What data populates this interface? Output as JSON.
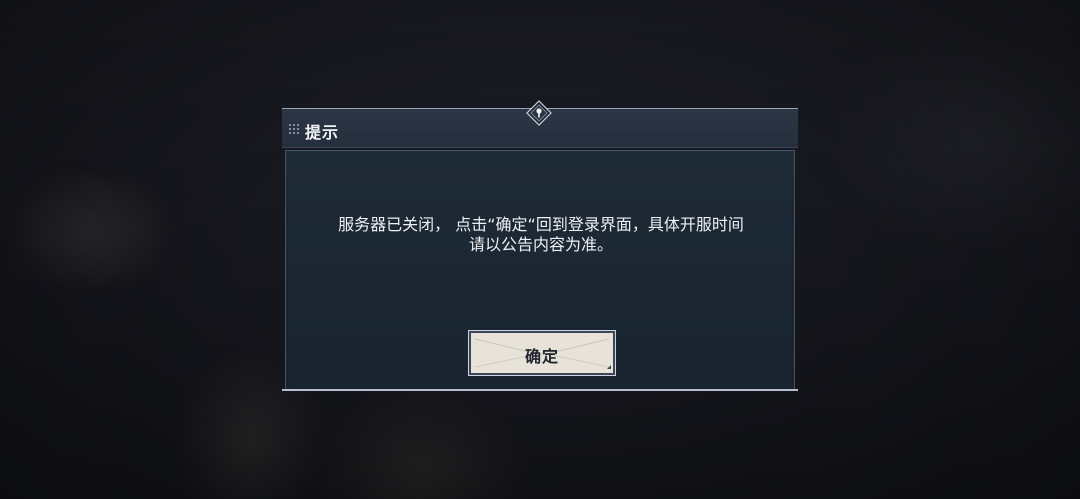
{
  "dialog": {
    "title": "提示",
    "message_line1": "服务器已关闭， 点击“确定“回到登录界面，具体开服时间",
    "message_line2": "请以公告内容为准。",
    "confirm_label": "确定",
    "header_icon": "diamond-emblem-icon",
    "grip_icon": "grip-dots-icon"
  }
}
